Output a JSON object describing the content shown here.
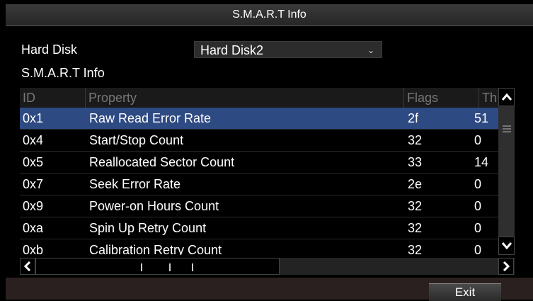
{
  "window": {
    "title": "S.M.A.R.T Info"
  },
  "form": {
    "hard_disk_label": "Hard Disk",
    "hard_disk_value": "Hard Disk2",
    "section_label": "S.M.A.R.T Info"
  },
  "table": {
    "headers": {
      "id": "ID",
      "property": "Property",
      "flags": "Flags",
      "threshold": "Th"
    },
    "rows": [
      {
        "id": "0x1",
        "property": "Raw Read Error Rate",
        "flags": "2f",
        "threshold": "51",
        "selected": true
      },
      {
        "id": "0x4",
        "property": "Start/Stop Count",
        "flags": "32",
        "threshold": "0"
      },
      {
        "id": "0x5",
        "property": "Reallocated Sector Count",
        "flags": "33",
        "threshold": "14"
      },
      {
        "id": "0x7",
        "property": "Seek Error Rate",
        "flags": "2e",
        "threshold": "0"
      },
      {
        "id": "0x9",
        "property": "Power-on Hours Count",
        "flags": "32",
        "threshold": "0"
      },
      {
        "id": "0xa",
        "property": "Spin Up Retry Count",
        "flags": "32",
        "threshold": "0"
      },
      {
        "id": "0xb",
        "property": "Calibration Retry Count",
        "flags": "32",
        "threshold": "0"
      }
    ]
  },
  "footer": {
    "exit_label": "Exit"
  },
  "colors": {
    "selected_row": "#2e4a82",
    "background": "#000000"
  }
}
